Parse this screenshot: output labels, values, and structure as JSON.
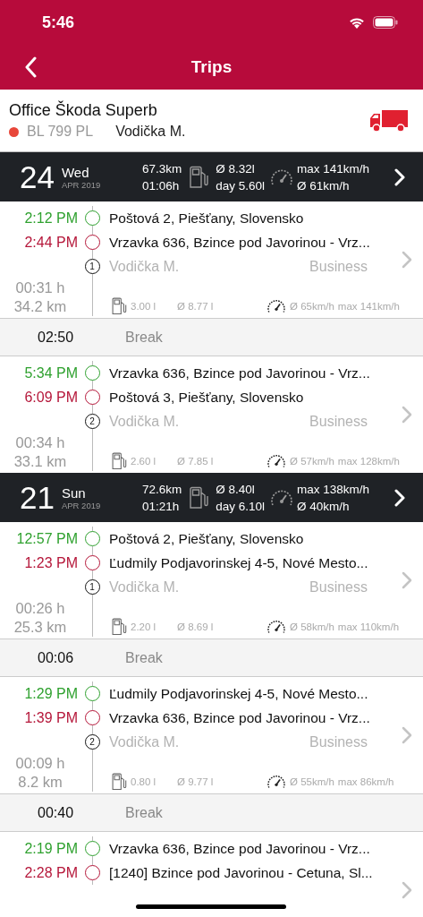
{
  "status_bar": {
    "time": "5:46"
  },
  "nav": {
    "title": "Trips"
  },
  "vehicle": {
    "name": "Office Škoda Superb",
    "plate": "BL 799 PL",
    "driver": "Vodička M."
  },
  "items": [
    {
      "kind": "day",
      "day": "24",
      "weekday": "Wed",
      "month": "APR 2019",
      "distance": "67.3km",
      "duration": "01:06h",
      "avg_consumption": "Ø 8.32l",
      "day_consumption": "day 5.60l",
      "max_speed": "max 141km/h",
      "avg_speed": "Ø 61km/h"
    },
    {
      "kind": "trip",
      "start_time": "2:12 PM",
      "start_place": "Poštová 2, Piešťany, Slovensko",
      "end_time": "2:44 PM",
      "end_place": "Vrzavka 636, Bzince pod Javorinou - Vrz...",
      "number": "1",
      "driver": "Vodička M.",
      "purpose": "Business",
      "duration": "00:31 h",
      "distance": "34.2 km",
      "fuel": "3.00 l",
      "avg_consumption": "Ø 8.77 l",
      "avg_speed": "Ø 65km/h",
      "max_speed": "max 141km/h"
    },
    {
      "kind": "break",
      "duration": "02:50",
      "label": "Break"
    },
    {
      "kind": "trip",
      "start_time": "5:34 PM",
      "start_place": "Vrzavka 636, Bzince pod Javorinou - Vrz...",
      "end_time": "6:09 PM",
      "end_place": "Poštová 3, Piešťany, Slovensko",
      "number": "2",
      "driver": "Vodička M.",
      "purpose": "Business",
      "duration": "00:34 h",
      "distance": "33.1 km",
      "fuel": "2.60 l",
      "avg_consumption": "Ø 7.85 l",
      "avg_speed": "Ø 57km/h",
      "max_speed": "max 128km/h"
    },
    {
      "kind": "day",
      "day": "21",
      "weekday": "Sun",
      "month": "APR 2019",
      "distance": "72.6km",
      "duration": "01:21h",
      "avg_consumption": "Ø 8.40l",
      "day_consumption": "day 6.10l",
      "max_speed": "max 138km/h",
      "avg_speed": "Ø 40km/h"
    },
    {
      "kind": "trip",
      "start_time": "12:57 PM",
      "start_place": "Poštová 2, Piešťany, Slovensko",
      "end_time": "1:23 PM",
      "end_place": "Ľudmily Podjavorinskej 4-5, Nové Mesto...",
      "number": "1",
      "driver": "Vodička M.",
      "purpose": "Business",
      "duration": "00:26 h",
      "distance": "25.3 km",
      "fuel": "2.20 l",
      "avg_consumption": "Ø 8.69 l",
      "avg_speed": "Ø 58km/h",
      "max_speed": "max 110km/h"
    },
    {
      "kind": "break",
      "duration": "00:06",
      "label": "Break"
    },
    {
      "kind": "trip",
      "start_time": "1:29 PM",
      "start_place": "Ľudmily Podjavorinskej 4-5, Nové Mesto...",
      "end_time": "1:39 PM",
      "end_place": "Vrzavka 636, Bzince pod Javorinou - Vrz...",
      "number": "2",
      "driver": "Vodička M.",
      "purpose": "Business",
      "duration": "00:09 h",
      "distance": "8.2 km",
      "fuel": "0.80 l",
      "avg_consumption": "Ø 9.77 l",
      "avg_speed": "Ø 55km/h",
      "max_speed": "max 86km/h"
    },
    {
      "kind": "break",
      "duration": "00:40",
      "label": "Break"
    },
    {
      "kind": "trip",
      "start_time": "2:19 PM",
      "start_place": "Vrzavka 636, Bzince pod Javorinou - Vrz...",
      "end_time": "2:28 PM",
      "end_place": "[1240] Bzince pod Javorinou - Cetuna, Sl..."
    }
  ]
}
